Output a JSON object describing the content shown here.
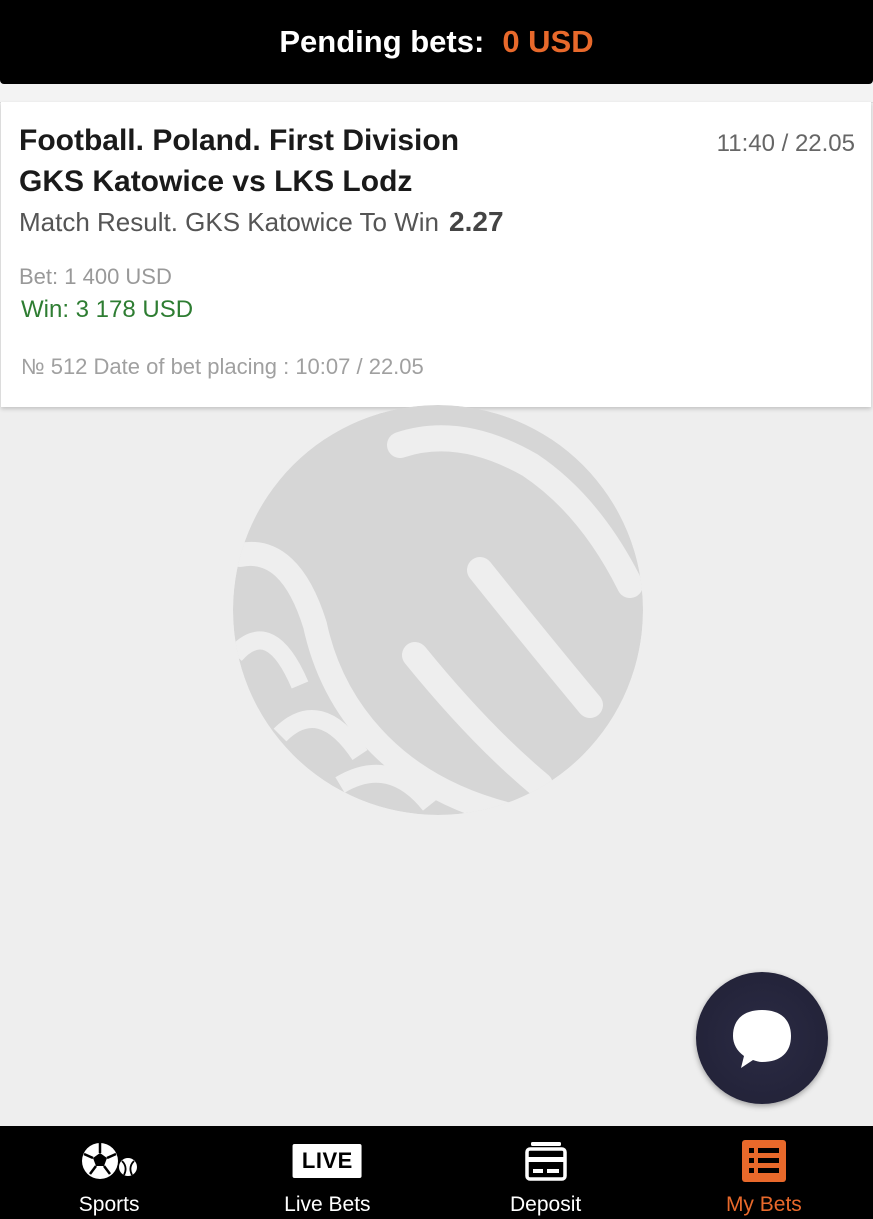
{
  "header": {
    "pending_label": "Pending bets:",
    "pending_value": "0 USD",
    "accent_color": "#e8692b"
  },
  "bet_card": {
    "league": "Football. Poland. First Division",
    "match": "GKS Katowice vs LKS Lodz",
    "event_time": "11:40 / 22.05",
    "market": "Match Result. GKS Katowice To Win",
    "odds": "2.27",
    "bet_amount": "Bet: 1 400 USD",
    "win_amount": "Win: 3 178 USD",
    "meta": "№ 512 Date of bet placing : 10:07 / 22.05"
  },
  "chat": {
    "icon": "chat-bubble-icon"
  },
  "bottom_nav": {
    "items": [
      {
        "label": "Sports",
        "icon": "sports-ball-icon"
      },
      {
        "label": "Live Bets",
        "icon": "live-icon",
        "badge": "LIVE"
      },
      {
        "label": "Deposit",
        "icon": "deposit-card-icon"
      },
      {
        "label": "My Bets",
        "icon": "list-icon",
        "active": true
      }
    ]
  }
}
